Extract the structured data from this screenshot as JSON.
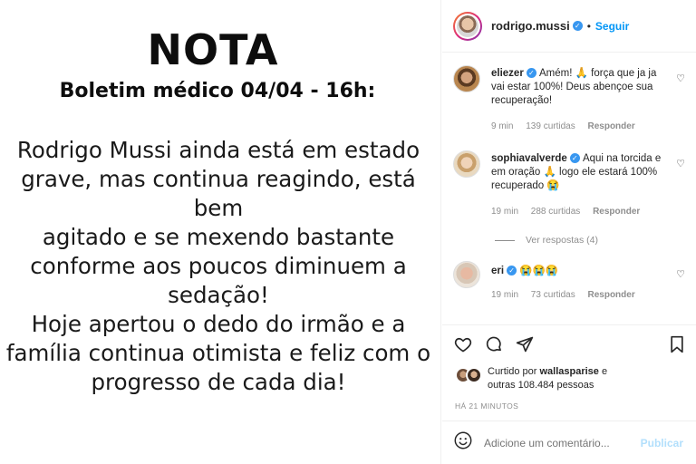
{
  "post": {
    "title": "NOTA",
    "subtitle": "Boletim médico 04/04 - 16h:",
    "body_lines": [
      "Rodrigo Mussi ainda está em estado",
      "grave, mas continua reagindo, está bem",
      "agitado e se mexendo bastante",
      "conforme aos poucos diminuem a",
      "sedação!",
      "Hoje apertou o dedo do irmão e a",
      "família continua otimista e feliz com o",
      "progresso de cada dia!"
    ]
  },
  "header": {
    "username": "rodrigo.mussi",
    "verified_glyph": "✓",
    "separator": "•",
    "follow_label": "Seguir"
  },
  "comments": [
    {
      "user": "eliezer",
      "text": "Amém! 🙏 força que ja ja vai estar 100%! Deus abençoe sua recuperação!",
      "time": "9 min",
      "likes": "139 curtidas",
      "reply": "Responder"
    },
    {
      "user": "sophiavalverde",
      "text": "Aqui na torcida e em oração 🙏 logo ele estará 100% recuperado 😭",
      "time": "19 min",
      "likes": "288 curtidas",
      "reply": "Responder"
    },
    {
      "user": "eri",
      "text": "😭😭😭",
      "time": "19 min",
      "likes": "73 curtidas",
      "reply": "Responder"
    }
  ],
  "view_replies": "Ver respostas (4)",
  "likes": {
    "prefix": "Curtido por",
    "user": "wallasparise",
    "suffix": "e outras 108.484 pessoas"
  },
  "time_ago": "HÁ 21 MINUTOS",
  "add_comment": {
    "placeholder": "Adicione um comentário...",
    "publish_label": "Publicar"
  },
  "icons": {
    "like": "heart-icon",
    "comment": "comment-icon",
    "share": "share-icon",
    "save": "bookmark-icon",
    "emoji": "emoji-icon"
  },
  "colors": {
    "accent": "#0095f6",
    "verified": "#3897f0",
    "muted": "#8e8e8e",
    "publish_disabled": "#b2dffc"
  }
}
